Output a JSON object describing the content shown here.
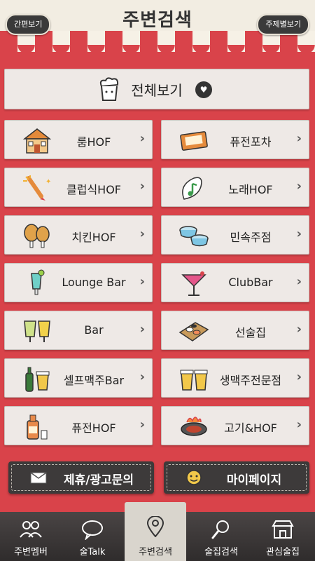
{
  "header": {
    "title": "주변검색",
    "left_button": "간편보기",
    "right_button": "주제별보기"
  },
  "all_view": {
    "label": "전체보기",
    "icon": "cup-icon",
    "badge_icon": "heart-icon"
  },
  "categories": [
    {
      "label": "룸HOF",
      "icon": "house-icon"
    },
    {
      "label": "퓨전포차",
      "icon": "sign-icon"
    },
    {
      "label": "클럽식HOF",
      "icon": "firework-icon"
    },
    {
      "label": "노래HOF",
      "icon": "music-note-icon"
    },
    {
      "label": "치킨HOF",
      "icon": "chicken-icon"
    },
    {
      "label": "민속주점",
      "icon": "bowls-icon"
    },
    {
      "label": "Lounge Bar",
      "icon": "cocktail-glass-icon"
    },
    {
      "label": "ClubBar",
      "icon": "martini-icon"
    },
    {
      "label": "Bar",
      "icon": "beer-glasses-icon"
    },
    {
      "label": "선술집",
      "icon": "sushi-icon"
    },
    {
      "label": "셀프맥주Bar",
      "icon": "beer-bottle-icon"
    },
    {
      "label": "생맥주전문점",
      "icon": "draft-beer-icon"
    },
    {
      "label": "퓨전HOF",
      "icon": "liquor-bottle-icon"
    },
    {
      "label": "고기&HOF",
      "icon": "grill-icon"
    }
  ],
  "bottom_buttons": {
    "partnership": "제휴/광고문의",
    "mypage": "마이페이지"
  },
  "tabs": [
    {
      "label": "주변멤버",
      "icon": "people-icon"
    },
    {
      "label": "술Talk",
      "icon": "chat-icon"
    },
    {
      "label": "주변검색",
      "icon": "location-pin-icon"
    },
    {
      "label": "술집검색",
      "icon": "search-icon"
    },
    {
      "label": "관심술집",
      "icon": "store-icon"
    }
  ],
  "colors": {
    "accent_red": "#d9434a",
    "card": "#eee9e6",
    "dark": "#3d3a3a"
  }
}
